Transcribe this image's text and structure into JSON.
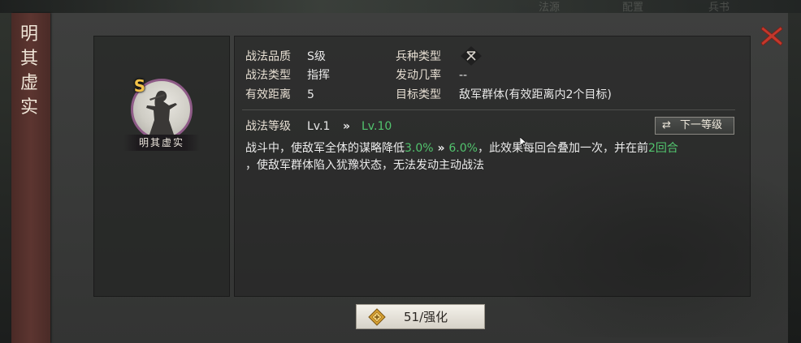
{
  "top_tabs": [
    "法源",
    "配置",
    "兵书"
  ],
  "tactic_name": "明其虚实",
  "grade": "S",
  "colors": {
    "green_highlight": "#52c46e",
    "portrait_ring": "#8e5b87",
    "grade_gold": "#f2c24a",
    "close_red": "#c3382c"
  },
  "info": {
    "quality_label": "战法品质",
    "quality_value": "S级",
    "troop_label": "兵种类型",
    "troop_icon": "troop-type-icon",
    "type_label": "战法类型",
    "type_value": "指挥",
    "rate_label": "发动几率",
    "rate_value": "--",
    "range_label": "有效距离",
    "range_value": "5",
    "target_label": "目标类型",
    "target_value": "敌军群体(有效距离内2个目标)"
  },
  "level": {
    "label": "战法等级",
    "current": "Lv.1",
    "arrow": "»",
    "max": "Lv.10",
    "next_button": "下一等级",
    "next_icon": "swap-arrows-icon"
  },
  "description": {
    "part1": "战斗中，使敌军全体的谋略降低",
    "value_from": "3.0%",
    "arrow": "»",
    "value_to": "6.0%",
    "part2": "，此效果每回合叠加一次，并在前",
    "rounds": "2回合",
    "part3": "，使敌军群体陷入犹豫状态，无法发动主动战法"
  },
  "enhance": {
    "label": "51/强化",
    "icon": "enhance-token-icon"
  }
}
